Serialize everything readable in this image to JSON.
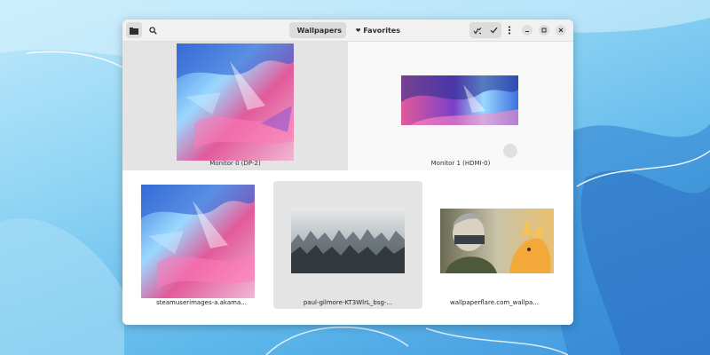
{
  "header": {
    "tabs": [
      {
        "label": "Wallpapers",
        "icon": "monitor-icon",
        "active": true
      },
      {
        "label": "Favorites",
        "icon": "heart-icon",
        "active": false
      }
    ],
    "left_buttons": [
      "folder-icon",
      "search-icon"
    ],
    "right_buttons": [
      "apply-tool-icon",
      "checkmark-icon",
      "kebab-menu-icon"
    ],
    "window_controls": [
      "minimize-icon",
      "maximize-icon",
      "close-icon"
    ]
  },
  "monitors": [
    {
      "label": "Monitor 0 (DP-2)",
      "selected": true
    },
    {
      "label": "Monitor 1 (HDMI-0)",
      "selected": false
    }
  ],
  "wallpapers": [
    {
      "label": "steamuserimages-a.akama...",
      "selected": false
    },
    {
      "label": "paul-gilmore-KT3WlrL_bsg-...",
      "selected": true
    },
    {
      "label": "wallpaperflare.com_wallpa...",
      "selected": false
    }
  ],
  "colors": {
    "desktop_gradient_start": "#bfe9fb",
    "desktop_gradient_end": "#3f93dc",
    "headerbar": "#f1f1f1",
    "selection": "#e4e4e4"
  }
}
